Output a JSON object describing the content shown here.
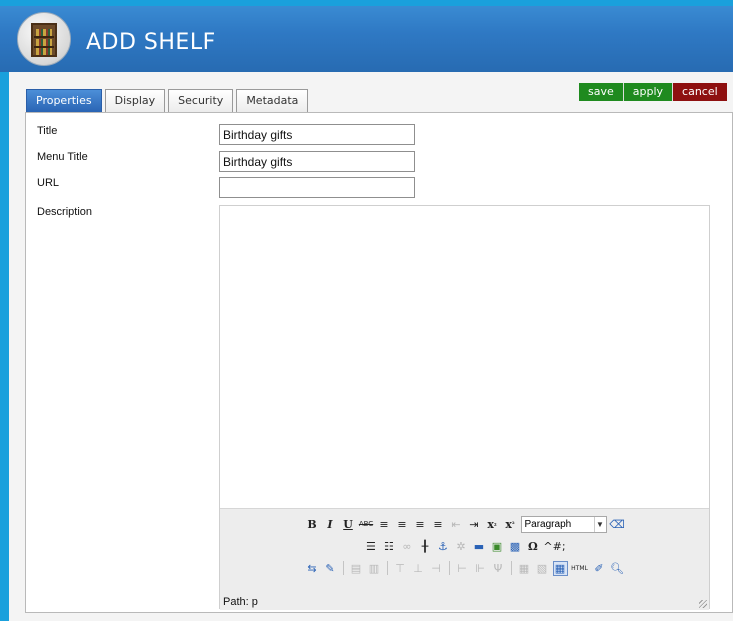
{
  "header": {
    "title": "ADD SHELF",
    "logo_icon": "bookshelf-icon"
  },
  "tabs": [
    {
      "label": "Properties",
      "active": true
    },
    {
      "label": "Display",
      "active": false
    },
    {
      "label": "Security",
      "active": false
    },
    {
      "label": "Metadata",
      "active": false
    }
  ],
  "actions": {
    "save": "save",
    "apply": "apply",
    "cancel": "cancel"
  },
  "form": {
    "title": {
      "label": "Title",
      "value": "Birthday gifts"
    },
    "menu_title": {
      "label": "Menu Title",
      "value": "Birthday gifts"
    },
    "url": {
      "label": "URL",
      "value": ""
    },
    "description": {
      "label": "Description"
    }
  },
  "editor": {
    "format_select": "Paragraph",
    "path": "Path: p",
    "char_label": "^#;"
  },
  "colors": {
    "accent": "#2a64b4",
    "save": "#1f8a1f",
    "cancel": "#8e1010",
    "background": "#1aa0dc"
  }
}
